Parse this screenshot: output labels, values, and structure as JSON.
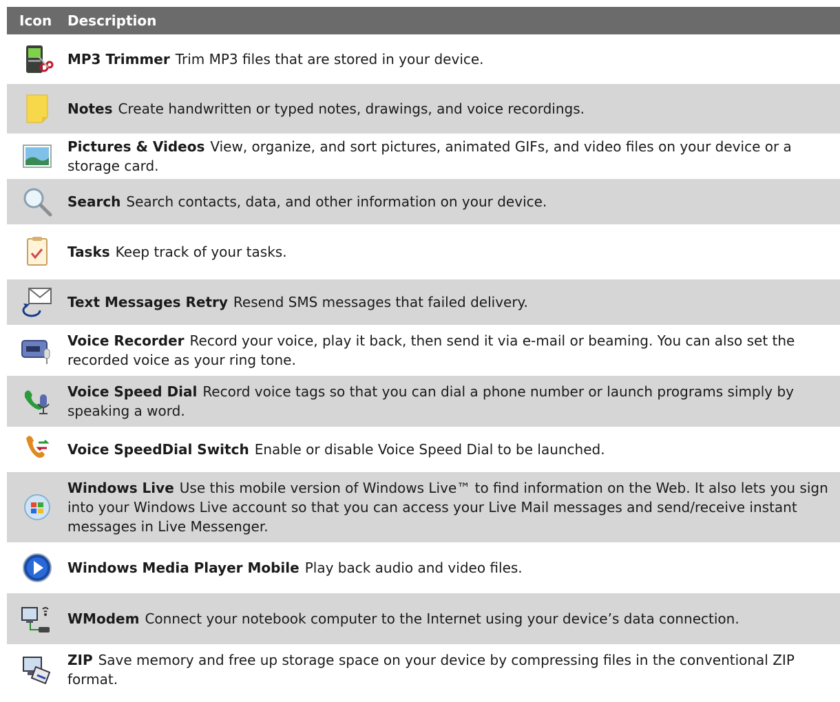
{
  "header": {
    "icon": "Icon",
    "description": "Description"
  },
  "rows": [
    {
      "title": "MP3 Trimmer",
      "desc": "Trim MP3 files that are stored in your device.",
      "icon": "mp3-trimmer-icon"
    },
    {
      "title": "Notes",
      "desc": "Create handwritten or typed notes, drawings, and voice recordings.",
      "icon": "notes-icon"
    },
    {
      "title": "Pictures & Videos",
      "desc": "View, organize, and sort pictures, animated GIFs, and video files on your device or a storage card.",
      "icon": "pictures-videos-icon"
    },
    {
      "title": "Search",
      "desc": "Search contacts, data, and other information on your device.",
      "icon": "search-icon"
    },
    {
      "title": "Tasks",
      "desc": "Keep track of your tasks.",
      "icon": "tasks-icon"
    },
    {
      "title": "Text Messages Retry",
      "desc": "Resend SMS messages that failed delivery.",
      "icon": "text-messages-retry-icon"
    },
    {
      "title": "Voice Recorder",
      "desc": "Record your voice, play it back, then send it via e-mail or beaming. You can also set the recorded voice as your ring tone.",
      "icon": "voice-recorder-icon"
    },
    {
      "title": "Voice Speed Dial",
      "desc": "Record voice tags so that you can dial a phone number or launch programs simply by speaking a word.",
      "icon": "voice-speed-dial-icon"
    },
    {
      "title": "Voice SpeedDial Switch",
      "desc": "Enable or disable Voice Speed Dial to be launched.",
      "icon": "voice-speeddial-switch-icon"
    },
    {
      "title": "Windows Live",
      "desc": "Use this mobile version of Windows Live™ to find information on the Web. It also lets you sign into your Windows Live account so that you can access your Live Mail messages and send/receive instant messages in Live Messenger.",
      "icon": "windows-live-icon"
    },
    {
      "title": "Windows Media Player Mobile",
      "desc": "Play back audio and video files.",
      "icon": "windows-media-player-icon"
    },
    {
      "title": "WModem",
      "desc": "Connect your notebook computer to the Internet using your device’s data connection.",
      "icon": "wmodem-icon"
    },
    {
      "title": "ZIP",
      "desc": "Save memory and free up storage space on your device by compressing files in the conventional ZIP format.",
      "icon": "zip-icon"
    }
  ]
}
